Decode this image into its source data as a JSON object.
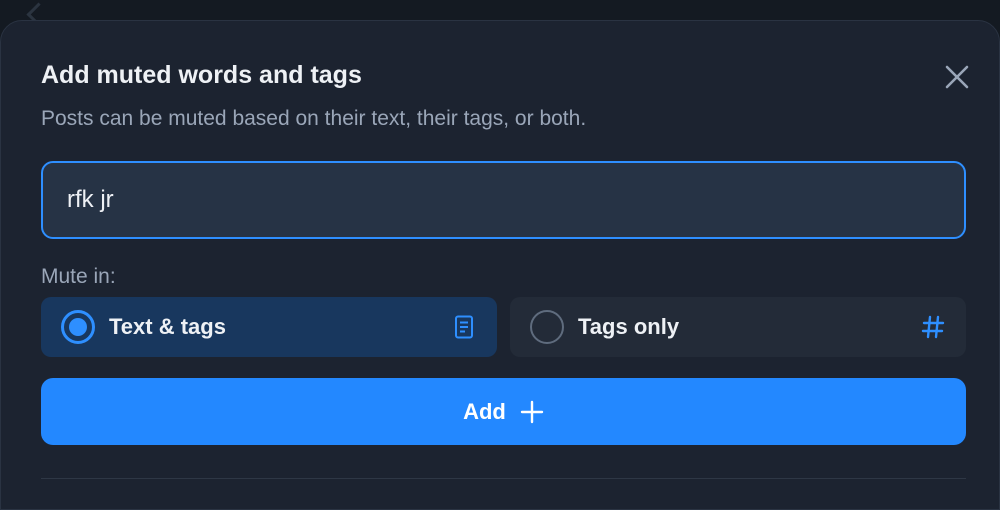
{
  "dialog": {
    "title": "Add muted words and tags",
    "subtitle": "Posts can be muted based on their text, their tags, or both.",
    "close_icon": "close-icon"
  },
  "input": {
    "value": "rfk jr",
    "placeholder": ""
  },
  "mute_in": {
    "label": "Mute in:",
    "options": [
      {
        "label": "Text & tags",
        "selected": true,
        "icon": "document-icon"
      },
      {
        "label": "Tags only",
        "selected": false,
        "icon": "hashtag-icon"
      }
    ]
  },
  "add_button": {
    "label": "Add",
    "icon": "plus-icon"
  },
  "colors": {
    "accent": "#2388ff",
    "selected_bg": "#18375e",
    "dialog_bg": "#1c2330"
  }
}
